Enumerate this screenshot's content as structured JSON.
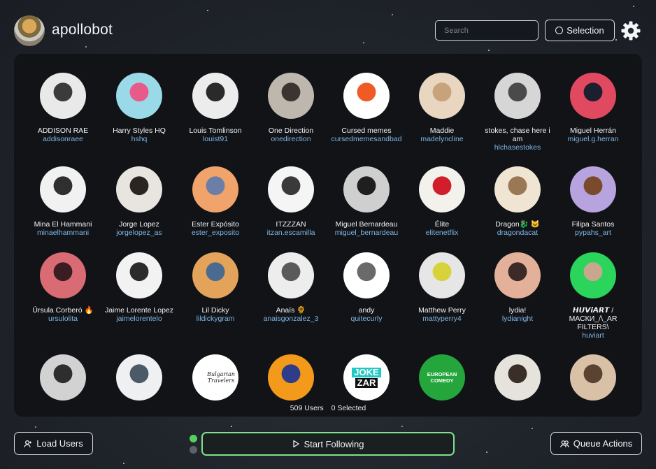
{
  "app": {
    "title": "apollobot"
  },
  "header": {
    "search_placeholder": "Search",
    "selection_label": "Selection"
  },
  "users": [
    {
      "name": "ADDISON RAE",
      "handle": "addisonraee",
      "colors": [
        "#e9e9e9",
        "#3b3b3b"
      ]
    },
    {
      "name": "Harry Styles HQ",
      "handle": "hshq",
      "colors": [
        "#9ad9e8",
        "#e85a8a"
      ]
    },
    {
      "name": "Louis Tomlinson",
      "handle": "louist91",
      "colors": [
        "#ececec",
        "#2a2a2a"
      ]
    },
    {
      "name": "One Direction",
      "handle": "onedirection",
      "colors": [
        "#bdb7ae",
        "#3a3530"
      ]
    },
    {
      "name": "Cursed memes",
      "handle": "cursedmemesandbad",
      "colors": [
        "#ffffff",
        "#ef5b24"
      ]
    },
    {
      "name": "Maddie",
      "handle": "madelyncline",
      "colors": [
        "#e9d6c1",
        "#c7a27b"
      ]
    },
    {
      "name": "stokes, chase here i am",
      "handle": "hlchasestokes",
      "colors": [
        "#d6d6d6",
        "#4a4a4a"
      ]
    },
    {
      "name": "Miguel Herrán",
      "handle": "miguel.g.herran",
      "colors": [
        "#e0495f",
        "#1e1f2e"
      ]
    },
    {
      "name": "Mina El Hammani",
      "handle": "minaelhammani",
      "colors": [
        "#f1f1f1",
        "#2f2f2f"
      ]
    },
    {
      "name": "Jorge Lopez",
      "handle": "jorgelopez_as",
      "colors": [
        "#e8e4df",
        "#2a2522"
      ]
    },
    {
      "name": "Ester Expósito",
      "handle": "ester_exposito",
      "colors": [
        "#f0a36b",
        "#6b7fa6"
      ]
    },
    {
      "name": "ITZZZAN",
      "handle": "itzan.escamilla",
      "colors": [
        "#f5f5f5",
        "#3a3a3a"
      ]
    },
    {
      "name": "Miguel Bernardeau",
      "handle": "miguel_bernardeau",
      "colors": [
        "#cfcfcf",
        "#1f1f1f"
      ]
    },
    {
      "name": "Élite",
      "handle": "elitenetflix",
      "colors": [
        "#f3f1ec",
        "#d21e2b"
      ]
    },
    {
      "name": "Dragon🐉 🐱",
      "handle": "dragondacat",
      "colors": [
        "#f0e4d2",
        "#9a7755"
      ]
    },
    {
      "name": "Filipa Santos",
      "handle": "pypahs_art",
      "colors": [
        "#b7a3dd",
        "#7a4a2c"
      ]
    },
    {
      "name": "Úrsula Corberó 🔥",
      "handle": "ursulolita",
      "colors": [
        "#d86b74",
        "#3a1d20"
      ]
    },
    {
      "name": "Jaime Lorente Lopez",
      "handle": "jaimelorentelo",
      "colors": [
        "#f2f2f2",
        "#2b2b2b"
      ]
    },
    {
      "name": "Lil Dicky",
      "handle": "lildickygram",
      "colors": [
        "#e4a35a",
        "#4a6b8f"
      ]
    },
    {
      "name": "Anaïs 🌻",
      "handle": "anaisgonzalez_3",
      "colors": [
        "#ededed",
        "#5a5a5a"
      ]
    },
    {
      "name": "andy",
      "handle": "quitecurly",
      "colors": [
        "#ffffff",
        "#6a6a6a"
      ]
    },
    {
      "name": "Matthew Perry",
      "handle": "mattyperry4",
      "colors": [
        "#e6e6e6",
        "#d8d23a"
      ]
    },
    {
      "name": "lydia!",
      "handle": "lydianight",
      "colors": [
        "#e3b09a",
        "#3b2a27"
      ]
    },
    {
      "name": "𝙃𝙐𝙑𝙞𝘼𝙍𝙏 / МАСКИ_/\\_AR FILTERS\\",
      "handle": "huviart",
      "colors": [
        "#2bd45a",
        "#c9a78f"
      ]
    },
    {
      "name": "",
      "handle": "",
      "colors": [
        "#d2d2d2",
        "#2e2e2e"
      ]
    },
    {
      "name": "",
      "handle": "",
      "colors": [
        "#eef0f2",
        "#4b5a66"
      ]
    },
    {
      "name": "",
      "handle": "",
      "colors": [
        "#ffffff",
        "#1a1a1a"
      ]
    },
    {
      "name": "",
      "handle": "",
      "colors": [
        "#f39a1b",
        "#2f3c8a"
      ]
    },
    {
      "name": "",
      "handle": "",
      "colors": [
        "#ffffff",
        "#22c9c4"
      ]
    },
    {
      "name": "",
      "handle": "",
      "colors": [
        "#24a63d",
        "#ffffff"
      ]
    },
    {
      "name": "",
      "handle": "",
      "colors": [
        "#e6e2dc",
        "#3a2f27"
      ]
    },
    {
      "name": "",
      "handle": "",
      "colors": [
        "#d9c1a7",
        "#5a4330"
      ]
    }
  ],
  "counts": {
    "users": "509 Users",
    "selected": "0 Selected"
  },
  "footer": {
    "load_label": "Load Users",
    "start_label": "Start Following",
    "queue_label": "Queue Actions"
  },
  "tile_text": {
    "bulgarian": "Bulgarian Travelers",
    "joke_1": "JOKE",
    "joke_2": "ZAR",
    "euro_1": "EUROPEAN",
    "euro_2": "COMEDY"
  },
  "colors": {
    "accent_green": "#54d062",
    "handle_blue": "#7fb6e6"
  }
}
